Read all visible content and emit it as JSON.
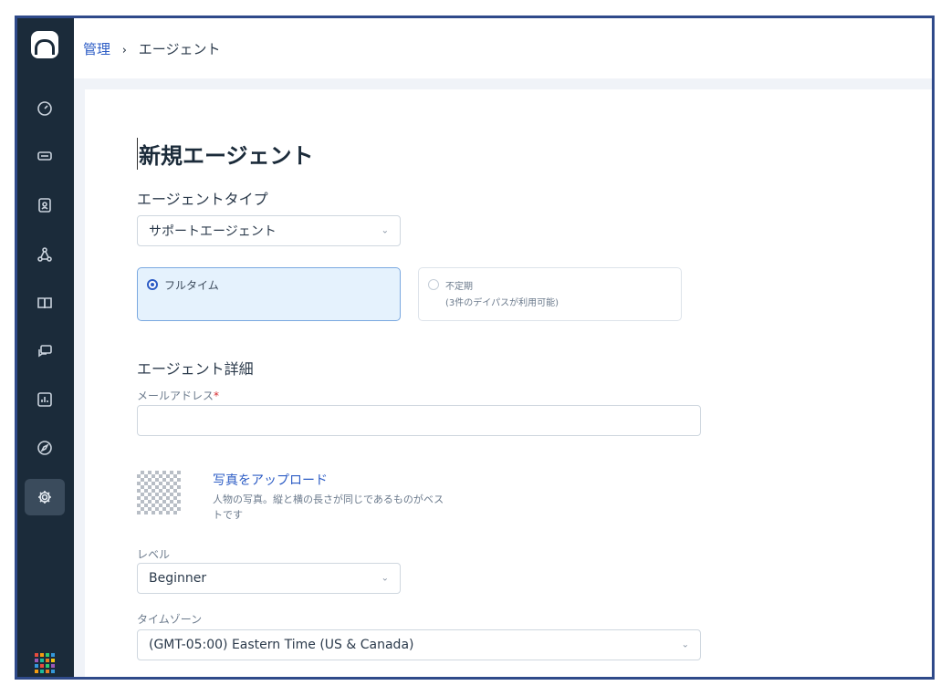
{
  "breadcrumb": {
    "parent": "管理",
    "separator": "›",
    "current": "エージェント"
  },
  "sidebar": {
    "items": [
      {
        "icon": "dashboard-icon"
      },
      {
        "icon": "tickets-icon"
      },
      {
        "icon": "contacts-icon"
      },
      {
        "icon": "social-icon"
      },
      {
        "icon": "knowledge-base-icon"
      },
      {
        "icon": "forums-icon"
      },
      {
        "icon": "reports-icon"
      },
      {
        "icon": "explore-icon"
      },
      {
        "icon": "admin-gear-icon",
        "active": true
      }
    ],
    "apps_icon": "apps-grid-icon"
  },
  "page": {
    "title": "新規エージェント",
    "agent_type_label": "エージェントタイプ",
    "agent_type_value": "サポートエージェント",
    "fulltime_label": "フルタイム",
    "occasional_label": "不定期",
    "occasional_sub": "(3件のデイパスが利用可能)",
    "details_label": "エージェント詳細",
    "email_label": "メールアドレス",
    "required_mark": "*",
    "email_value": "",
    "upload_label": "写真をアップロード",
    "upload_help": "人物の写真。縦と横の長さが同じであるものがベストです",
    "level_label": "レベル",
    "level_value": "Beginner",
    "timezone_label": "タイムゾーン",
    "timezone_value": "(GMT-05:00) Eastern Time (US & Canada)"
  },
  "colors": {
    "sidebar_bg": "#1b2b3a",
    "link": "#2c5cc5",
    "selected_card_bg": "#e5f2fd",
    "frame_border": "#2f4a8a"
  }
}
